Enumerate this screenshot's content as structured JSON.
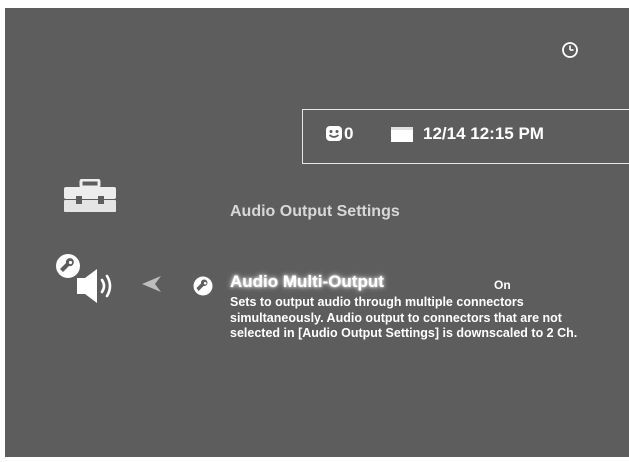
{
  "status": {
    "trophy_count": "0",
    "datetime": "12/14 12:15 PM",
    "icons": [
      "clock-icon",
      "smiley-icon",
      "calendar-icon"
    ]
  },
  "sidebar": {
    "icons": [
      "toolbox-icon",
      "wrench-icon",
      "speaker-icon",
      "back-arrow-icon"
    ]
  },
  "menu": {
    "section_title": "Audio Output Settings",
    "item": {
      "icon": "wrench-icon",
      "label": "Audio Multi-Output",
      "value": "On",
      "description": "Sets to output audio through multiple connectors simultaneously. Audio output to connectors that are not selected in [Audio Output Settings] is downscaled to 2 Ch."
    }
  },
  "colors": {
    "background": "#5d5d5d",
    "text": "#ffffff",
    "dim_text": "#d8d8d8",
    "accent_arrow": "#bdbdbd"
  }
}
